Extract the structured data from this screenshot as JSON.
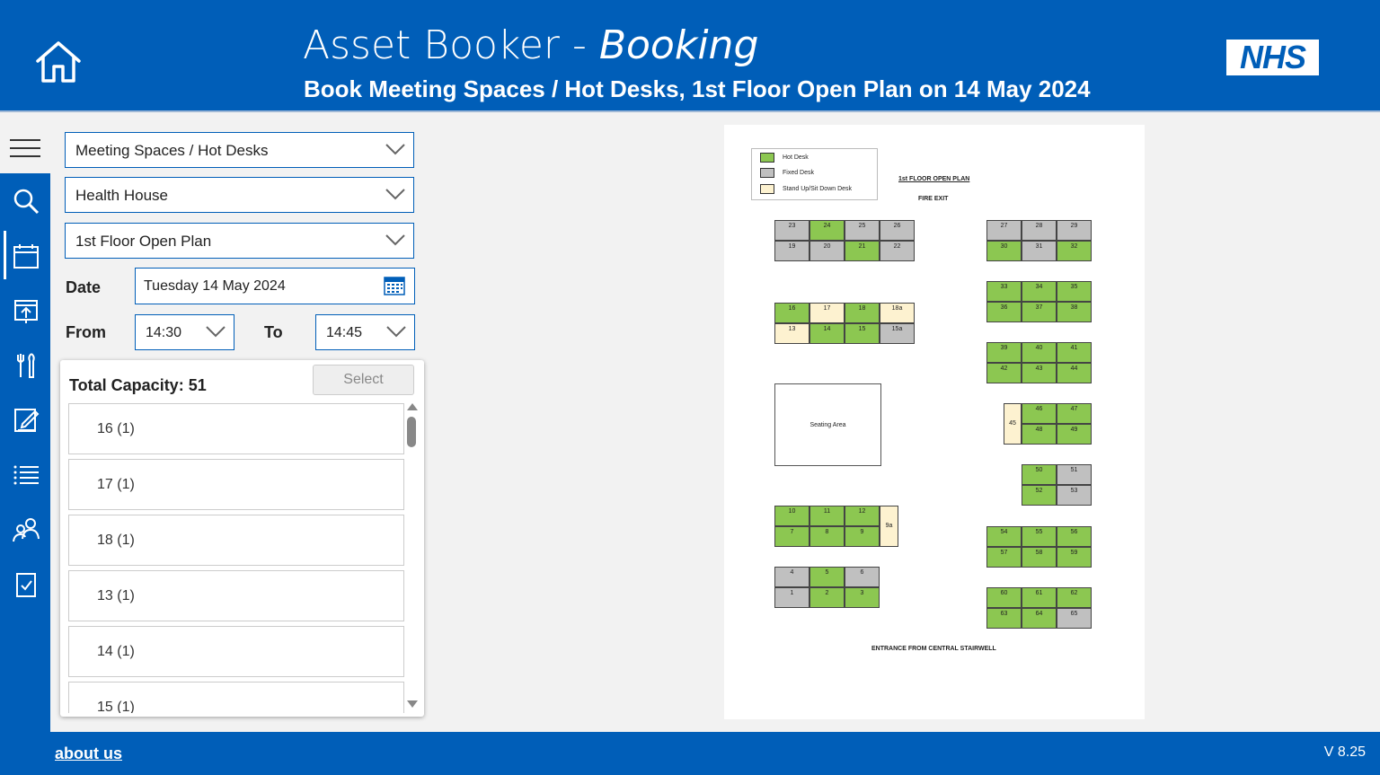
{
  "header": {
    "title_main": "Asset Booker - ",
    "title_em": "Booking",
    "subtitle": "Book Meeting Spaces / Hot Desks, 1st Floor Open Plan on 14 May 2024",
    "logo": "NHS"
  },
  "sidebar": {
    "icons": [
      "menu-icon",
      "search-icon",
      "calendar-icon",
      "presentation-calendar-icon",
      "tools-icon",
      "edit-form-icon",
      "list-icon",
      "users-icon",
      "checklist-icon"
    ]
  },
  "filters": {
    "asset_type": "Meeting Spaces / Hot Desks",
    "building": "Health House",
    "floor": "1st Floor Open Plan",
    "date_label": "Date",
    "date_value": "Tuesday 14 May 2024",
    "from_label": "From",
    "from_value": "14:30",
    "to_label": "To",
    "to_value": "14:45"
  },
  "results": {
    "capacity": "Total Capacity: 51",
    "select_label": "Select",
    "items": [
      "16 (1)",
      "17 (1)",
      "18 (1)",
      "13 (1)",
      "14 (1)",
      "15 (1)"
    ]
  },
  "floor_plan": {
    "legend": [
      {
        "label": "Hot Desk",
        "color": "#8cc751"
      },
      {
        "label": "Fixed Desk",
        "color": "#c0c0c0"
      },
      {
        "label": "Stand Up/Sit Down Desk",
        "color": "#fdf2d0"
      }
    ],
    "title": "1st FLOOR OPEN PLAN",
    "fire_exit": "FIRE EXIT",
    "seating_area": "Seating Area",
    "entrance": "ENTRANCE FROM CENTRAL STAIRWELL",
    "desks": [
      {
        "id": "23",
        "type": "fixed"
      },
      {
        "id": "24",
        "type": "hot"
      },
      {
        "id": "25",
        "type": "fixed"
      },
      {
        "id": "26",
        "type": "fixed"
      },
      {
        "id": "19",
        "type": "fixed"
      },
      {
        "id": "20",
        "type": "fixed"
      },
      {
        "id": "21",
        "type": "hot"
      },
      {
        "id": "22",
        "type": "fixed"
      },
      {
        "id": "27",
        "type": "fixed"
      },
      {
        "id": "28",
        "type": "fixed"
      },
      {
        "id": "29",
        "type": "fixed"
      },
      {
        "id": "30",
        "type": "hot"
      },
      {
        "id": "31",
        "type": "fixed"
      },
      {
        "id": "32",
        "type": "hot"
      },
      {
        "id": "16",
        "type": "hot"
      },
      {
        "id": "17",
        "type": "stand"
      },
      {
        "id": "18",
        "type": "hot"
      },
      {
        "id": "18a",
        "type": "stand"
      },
      {
        "id": "13",
        "type": "stand"
      },
      {
        "id": "14",
        "type": "hot"
      },
      {
        "id": "15",
        "type": "hot"
      },
      {
        "id": "15a",
        "type": "fixed"
      },
      {
        "id": "33",
        "type": "hot"
      },
      {
        "id": "34",
        "type": "hot"
      },
      {
        "id": "35",
        "type": "hot"
      },
      {
        "id": "36",
        "type": "hot"
      },
      {
        "id": "37",
        "type": "hot"
      },
      {
        "id": "38",
        "type": "hot"
      },
      {
        "id": "39",
        "type": "hot"
      },
      {
        "id": "40",
        "type": "hot"
      },
      {
        "id": "41",
        "type": "hot"
      },
      {
        "id": "42",
        "type": "hot"
      },
      {
        "id": "43",
        "type": "hot"
      },
      {
        "id": "44",
        "type": "hot"
      },
      {
        "id": "45",
        "type": "stand"
      },
      {
        "id": "46",
        "type": "hot"
      },
      {
        "id": "47",
        "type": "hot"
      },
      {
        "id": "48",
        "type": "hot"
      },
      {
        "id": "49",
        "type": "hot"
      },
      {
        "id": "50",
        "type": "hot"
      },
      {
        "id": "51",
        "type": "fixed"
      },
      {
        "id": "52",
        "type": "hot"
      },
      {
        "id": "53",
        "type": "fixed"
      },
      {
        "id": "10",
        "type": "hot"
      },
      {
        "id": "11",
        "type": "hot"
      },
      {
        "id": "12",
        "type": "hot"
      },
      {
        "id": "9a",
        "type": "stand"
      },
      {
        "id": "7",
        "type": "hot"
      },
      {
        "id": "8",
        "type": "hot"
      },
      {
        "id": "9",
        "type": "hot"
      },
      {
        "id": "54",
        "type": "hot"
      },
      {
        "id": "55",
        "type": "hot"
      },
      {
        "id": "56",
        "type": "hot"
      },
      {
        "id": "57",
        "type": "hot"
      },
      {
        "id": "58",
        "type": "hot"
      },
      {
        "id": "59",
        "type": "hot"
      },
      {
        "id": "4",
        "type": "fixed"
      },
      {
        "id": "5",
        "type": "hot"
      },
      {
        "id": "6",
        "type": "fixed"
      },
      {
        "id": "1",
        "type": "fixed"
      },
      {
        "id": "2",
        "type": "hot"
      },
      {
        "id": "3",
        "type": "hot"
      },
      {
        "id": "60",
        "type": "hot"
      },
      {
        "id": "61",
        "type": "hot"
      },
      {
        "id": "62",
        "type": "hot"
      },
      {
        "id": "63",
        "type": "hot"
      },
      {
        "id": "64",
        "type": "hot"
      },
      {
        "id": "65",
        "type": "fixed"
      }
    ]
  },
  "footer": {
    "about": "about us",
    "version": "V 8.25"
  }
}
